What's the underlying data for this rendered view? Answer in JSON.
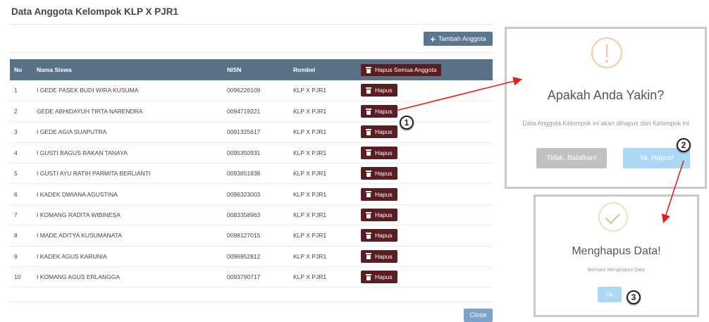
{
  "page": {
    "title": "Data Anggota Kelompok KLP X PJR1",
    "add_button_label": "Tambah Anggota",
    "close_button_label": "Close"
  },
  "table": {
    "headers": {
      "no": "No",
      "nama": "Nama Siswa",
      "nisn": "NISN",
      "rombel": "Rombel",
      "action": "Hapus Semua Anggota"
    },
    "delete_label": "Hapus",
    "rows": [
      {
        "no": "1",
        "nama": "I GEDE PASEK BUDI WIRA KUSUMA",
        "nisn": "0096226109",
        "rombel": "KLP X PJR1"
      },
      {
        "no": "2",
        "nama": "GEDE ABHIDAYUH TIRTA NARENDRA",
        "nisn": "0094719221",
        "rombel": "KLP X PJR1"
      },
      {
        "no": "3",
        "nama": "I GEDE AGIA SUAPUTRA",
        "nisn": "0091325617",
        "rombel": "KLP X PJR1"
      },
      {
        "no": "4",
        "nama": "I GUSTI BAGUS RAKAN TANAYA",
        "nisn": "0095350931",
        "rombel": "KLP X PJR1"
      },
      {
        "no": "5",
        "nama": "I GUSTI AYU RATIH PARMITA BERLIANTI",
        "nisn": "0093851838",
        "rombel": "KLP X PJR1"
      },
      {
        "no": "6",
        "nama": "I KADEK DWIANA AGUSTINA",
        "nisn": "0096323003",
        "rombel": "KLP X PJR1"
      },
      {
        "no": "7",
        "nama": "I KOMANG RADITA WIBINESA",
        "nisn": "0083358963",
        "rombel": "KLP X PJR1"
      },
      {
        "no": "8",
        "nama": "I MADE ADITYA KUSUMANATA",
        "nisn": "0098127015",
        "rombel": "KLP X PJR1"
      },
      {
        "no": "9",
        "nama": "I KADEK AGUS KARUNIA",
        "nisn": "0096952812",
        "rombel": "KLP X PJR1"
      },
      {
        "no": "10",
        "nama": "I KOMANG AGUS ERLANGGA",
        "nisn": "0093790717",
        "rombel": "KLP X PJR1"
      }
    ]
  },
  "confirm_dialog": {
    "title": "Apakah Anda Yakin?",
    "text": "Data Anggota Kelompok ini akan dihapus dari Kelompok ini",
    "cancel_label": "Tidak, Batalkan!",
    "confirm_label": "Ya, Hapus!"
  },
  "success_dialog": {
    "title": "Menghapus Data!",
    "text": "Berhasil Menghapus Data",
    "ok_label": "OK"
  },
  "step_badges": [
    "1",
    "2",
    "3"
  ],
  "colors": {
    "header_bg": "#5a7188",
    "delete_button": "#5a1e22",
    "add_button": "#5b7690",
    "close_button": "#7ca3c9",
    "confirm_button": "#aad8f5",
    "cancel_button": "#c1c1c1",
    "warning_icon": "#f5c89a",
    "success_icon": "#a5d68a",
    "annotation_arrow": "#e02020"
  },
  "icons": {
    "add": "plus-icon",
    "delete": "trash-icon",
    "warning": "exclamation-circle-icon",
    "success": "check-circle-icon"
  }
}
